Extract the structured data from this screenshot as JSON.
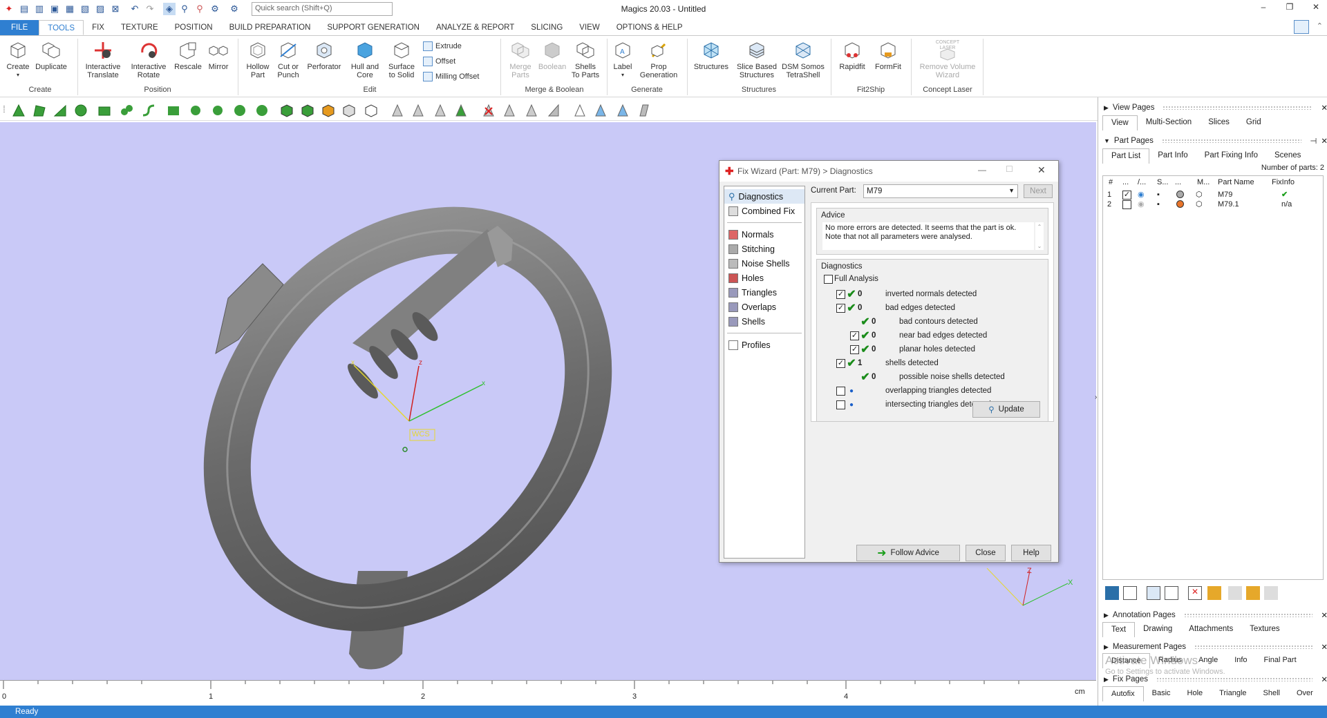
{
  "app": {
    "title": "Magics 20.03 - Untitled",
    "search_placeholder": "Quick search (Shift+Q)",
    "status": "Ready"
  },
  "tabs": [
    {
      "label": "FILE"
    },
    {
      "label": "TOOLS"
    },
    {
      "label": "FIX"
    },
    {
      "label": "TEXTURE"
    },
    {
      "label": "POSITION"
    },
    {
      "label": "BUILD PREPARATION"
    },
    {
      "label": "SUPPORT GENERATION"
    },
    {
      "label": "ANALYZE & REPORT"
    },
    {
      "label": "SLICING"
    },
    {
      "label": "VIEW"
    },
    {
      "label": "OPTIONS & HELP"
    }
  ],
  "ribbon": {
    "create": {
      "create": "Create",
      "duplicate": "Duplicate",
      "group": "Create"
    },
    "position": {
      "translate_1": "Interactive",
      "translate_2": "Translate",
      "rotate_1": "Interactive",
      "rotate_2": "Rotate",
      "rescale": "Rescale",
      "mirror": "Mirror",
      "group": "Position"
    },
    "edit": {
      "hollow_1": "Hollow",
      "hollow_2": "Part",
      "cut_1": "Cut or",
      "cut_2": "Punch",
      "perforator": "Perforator",
      "hull_1": "Hull and",
      "hull_2": "Core",
      "surface_1": "Surface",
      "surface_2": "to Solid",
      "extrude": "Extrude",
      "offset": "Offset",
      "milling": "Milling Offset",
      "group": "Edit"
    },
    "merge": {
      "merge_1": "Merge",
      "merge_2": "Parts",
      "boolean": "Boolean",
      "shells_1": "Shells",
      "shells_2": "To Parts",
      "group": "Merge & Boolean"
    },
    "generate": {
      "label": "Label",
      "prop_1": "Prop",
      "prop_2": "Generation",
      "group": "Generate"
    },
    "structures": {
      "structures": "Structures",
      "slice_1": "Slice Based",
      "slice_2": "Structures",
      "dsm_1": "DSM Somos",
      "dsm_2": "TetraShell",
      "group": "Structures"
    },
    "fit2ship": {
      "rapidfit": "Rapidfit",
      "formfit": "FormFit",
      "group": "Fit2Ship"
    },
    "laser": {
      "logo": "CONCEPT LASER",
      "remove_1": "Remove Volume",
      "remove_2": "Wizard",
      "group": "Concept Laser"
    }
  },
  "viewport": {
    "wcs_label": "WCS",
    "axes": {
      "x": "x",
      "z": "z",
      "X": "X",
      "Z": "Z"
    },
    "ruler": {
      "ticks": [
        "0",
        "1",
        "2",
        "3",
        "4"
      ],
      "unit": "cm"
    }
  },
  "dialog": {
    "title": "Fix Wizard (Part: M79) > Diagnostics",
    "nav": [
      {
        "label": "Diagnostics"
      },
      {
        "label": "Combined Fix"
      },
      {
        "label": "Normals"
      },
      {
        "label": "Stitching"
      },
      {
        "label": "Noise Shells"
      },
      {
        "label": "Holes"
      },
      {
        "label": "Triangles"
      },
      {
        "label": "Overlaps"
      },
      {
        "label": "Shells"
      },
      {
        "label": "Profiles"
      }
    ],
    "current_part_label": "Current Part:",
    "current_part_value": "M79",
    "next": "Next",
    "advice_title": "Advice",
    "advice_text": "No more errors are detected. It seems that the part is ok. Note that not all parameters were analysed.",
    "diagnostics_title": "Diagnostics",
    "full_analysis": "Full Analysis",
    "rows": [
      {
        "count": "0",
        "label": "inverted normals detected"
      },
      {
        "count": "0",
        "label": "bad edges detected"
      },
      {
        "count": "0",
        "label": "bad contours detected"
      },
      {
        "count": "0",
        "label": "near bad edges detected"
      },
      {
        "count": "0",
        "label": "planar holes detected"
      },
      {
        "count": "1",
        "label": "shells detected"
      },
      {
        "count": "0",
        "label": "possible noise shells detected"
      },
      {
        "count": "",
        "label": "overlapping triangles detected"
      },
      {
        "count": "",
        "label": "intersecting triangles detected"
      }
    ],
    "update": "Update",
    "follow_advice": "Follow Advice",
    "close": "Close",
    "help": "Help"
  },
  "right_panel": {
    "view_pages": "View Pages",
    "view_tabs": [
      {
        "label": "View"
      },
      {
        "label": "Multi-Section"
      },
      {
        "label": "Slices"
      },
      {
        "label": "Grid"
      }
    ],
    "part_pages": "Part Pages",
    "part_tabs": [
      {
        "label": "Part List"
      },
      {
        "label": "Part Info"
      },
      {
        "label": "Part Fixing Info"
      },
      {
        "label": "Scenes"
      }
    ],
    "num_parts": "Number of parts: 2",
    "columns": {
      "num": "#",
      "c1": "...",
      "c2": "/...",
      "c3": "S...",
      "c4": "...",
      "c5": "M...",
      "name": "Part Name",
      "fix": "FixInfo"
    },
    "parts": [
      {
        "num": "1",
        "name": "M79",
        "fix": "✔"
      },
      {
        "num": "2",
        "name": "M79.1",
        "fix": "n/a"
      }
    ],
    "annotation_pages": "Annotation Pages",
    "annotation_tabs": [
      {
        "label": "Text"
      },
      {
        "label": "Drawing"
      },
      {
        "label": "Attachments"
      },
      {
        "label": "Textures"
      }
    ],
    "measurement_pages": "Measurement Pages",
    "measurement_tabs": [
      {
        "label": "Distance"
      },
      {
        "label": "Radius"
      },
      {
        "label": "Angle"
      },
      {
        "label": "Info"
      },
      {
        "label": "Final Part"
      }
    ],
    "fix_pages": "Fix Pages",
    "fix_tabs": [
      {
        "label": "Autofix"
      },
      {
        "label": "Basic"
      },
      {
        "label": "Hole"
      },
      {
        "label": "Triangle"
      },
      {
        "label": "Shell"
      },
      {
        "label": "Over"
      }
    ],
    "watermark_1": "Activate Windows",
    "watermark_2": "Go to Settings to activate Windows."
  }
}
